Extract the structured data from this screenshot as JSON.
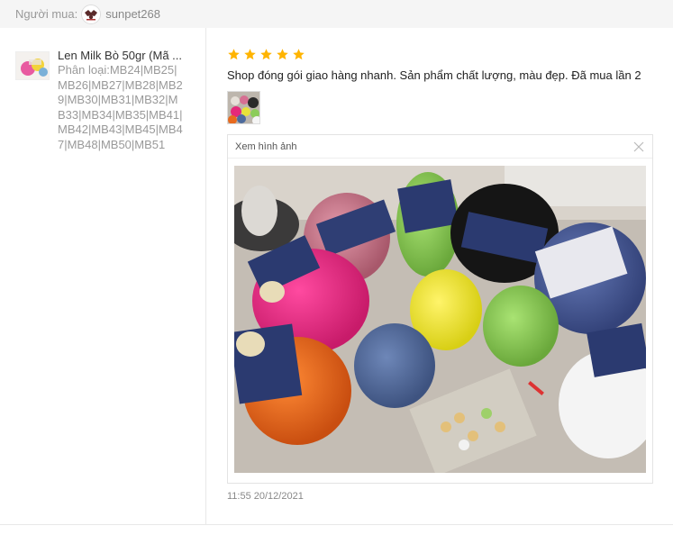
{
  "header": {
    "buyer_label": "Người mua:",
    "buyer_name": "sunpet268"
  },
  "product": {
    "name": "Len Milk Bò 50gr (Mã ...",
    "variant": "Phân loại:MB24|MB25|MB26|MB27|MB28|MB29|MB30|MB31|MB32|MB33|MB34|MB35|MB41|MB42|MB43|MB45|MB47|MB48|MB50|MB51"
  },
  "review": {
    "rating": 5,
    "star_color": "#ffb400",
    "comment": "Shop đóng gói giao hàng nhanh. Sản phẩm chất lượng, màu đẹp. Đã mua lần 2",
    "timestamp": "11:55 20/12/2021"
  },
  "viewer": {
    "title": "Xem hình ảnh",
    "close_icon": "close-icon"
  }
}
